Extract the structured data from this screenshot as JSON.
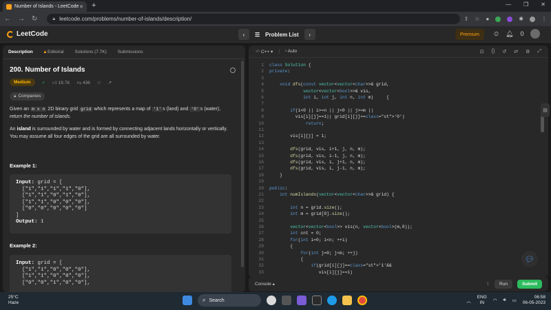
{
  "browser": {
    "tab_title": "Number of Islands - LeetCode",
    "tab_close": "✕",
    "new_tab": "+",
    "url": "leetcode.com/problems/number-of-islands/description/",
    "win_min": "—",
    "win_max": "❐",
    "win_close": "✕"
  },
  "nav": {
    "logo": "LeetCode",
    "problem_list": "Problem List",
    "premium": "Premium",
    "notif_count": "0"
  },
  "tabs": {
    "description": "Description",
    "editorial": "Editorial",
    "solutions": "Solutions (7.7K)",
    "submissions": "Submissions"
  },
  "problem": {
    "title": "200. Number of Islands",
    "difficulty": "Medium",
    "likes": "19.7K",
    "dislikes": "436",
    "companies": "Companies",
    "p1_a": "Given an ",
    "p1_code1": "m x n",
    "p1_b": " 2D binary grid ",
    "p1_code2": "grid",
    "p1_c": " which represents a map of ",
    "p1_code3": "'1'",
    "p1_d": "s (land) and ",
    "p1_code4": "'0'",
    "p1_e": "s (water),",
    "p1_f": "return the number of islands.",
    "p2_a": "An ",
    "p2_b": "island",
    "p2_c": " is surrounded by water and is formed by connecting adjacent lands horizontally or vertically. You may assume all four edges of the grid are all surrounded by water.",
    "ex1_head": "Example 1:",
    "ex1_input_label": "Input:",
    "ex1_input": " grid = [\n  [\"1\",\"1\",\"1\",\"1\",\"0\"],\n  [\"1\",\"1\",\"0\",\"1\",\"0\"],\n  [\"1\",\"1\",\"0\",\"0\",\"0\"],\n  [\"0\",\"0\",\"0\",\"0\",\"0\"]\n]",
    "ex1_output_label": "Output:",
    "ex1_output": " 1",
    "ex2_head": "Example 2:",
    "ex2_input_label": "Input:",
    "ex2_input": " grid = [\n  [\"1\",\"1\",\"0\",\"0\",\"0\"],\n  [\"1\",\"1\",\"0\",\"0\",\"0\"],\n  [\"0\",\"0\",\"1\",\"0\",\"0\"],"
  },
  "editor": {
    "language": "C++",
    "mode": "Auto",
    "lines": [
      "class Solution {",
      "private:",
      "",
      "    void dfs(const vector<vector<char>>& grid,",
      "             vector<vector<bool>>& vis,",
      "             int i, int j, int n, int m)     {",
      "",
      "        if(i<0 || i>=n || j<0 || j>=m ||",
      "          vis[i][j]==1|| grid[i][j]=='0')",
      "              return;",
      "",
      "        vis[i][j] = 1;",
      "",
      "        dfs(grid, vis, i+1, j, n, m);",
      "        dfs(grid, vis, i-1, j, n, m);",
      "        dfs(grid, vis, i, j+1, n, m);",
      "        dfs(grid, vis, i, j-1, n, m);",
      "    }",
      "",
      "public:",
      "    int numIslands(vector<vector<char>>& grid) {",
      "",
      "        int n = grid.size();",
      "        int m = grid[0].size();",
      "",
      "        vector<vector<bool>> vis(n, vector<bool>(m,0));",
      "        int cnt = 0;",
      "        for(int i=0; i<n; ++i)",
      "        {",
      "            for(int j=0; j<m; ++j)",
      "            {",
      "                if(grid[i][j]=='1'&&",
      "                   vis[i][j]==1)"
    ]
  },
  "console": {
    "label": "Console",
    "run": "Run",
    "submit": "Submit"
  },
  "taskbar": {
    "temp": "25°C",
    "weather": "Haze",
    "search": "Search",
    "lang1": "ENG",
    "lang2": "IN",
    "time": "06:58",
    "date": "06-05-2023"
  }
}
